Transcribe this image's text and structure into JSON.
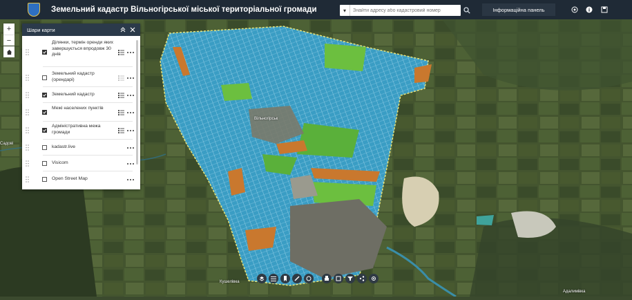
{
  "header": {
    "title": "Земельний кадастр Вільногірської міської територіальної громади",
    "search_placeholder": "Знайти адресу або кадастровий номер",
    "info_panel_label": "Інформаційна панель",
    "icons": [
      "search-icon",
      "map-icon",
      "info-icon",
      "save-icon"
    ]
  },
  "colors": {
    "header_bg": "#1f2a36",
    "parcel_blue": "#3a9dc4",
    "parcel_green": "#6cbf3f",
    "parcel_orange": "#c9782e",
    "boundary": "#e8e57a"
  },
  "map_controls": {
    "zoom_in": "+",
    "zoom_out": "−"
  },
  "layers_panel": {
    "title": "Шари карти",
    "layers": [
      {
        "name": "Ділянки, термін оренди яких завершується впродовж 30 днів",
        "checked": true,
        "legend": true
      },
      {
        "name": "Земельний кадастр (орендарі)",
        "checked": false,
        "legend": true
      },
      {
        "name": "Земельний кадастр",
        "checked": true,
        "legend": true
      },
      {
        "name": "Межі населених пунктів",
        "checked": true,
        "legend": true
      },
      {
        "name": "Адміністративна межа громади",
        "checked": true,
        "legend": true
      },
      {
        "name": "kadastr.live",
        "checked": false,
        "legend": false
      },
      {
        "name": "Visicom",
        "checked": false,
        "legend": false
      },
      {
        "name": "Open Street Map",
        "checked": false,
        "legend": false
      }
    ]
  },
  "toolbar": {
    "tools": [
      "layers-icon",
      "legend-icon",
      "bookmark-icon",
      "measure-icon",
      "draw-icon",
      "print-icon",
      "basemap-icon",
      "filter-icon",
      "share-icon",
      "locate-icon"
    ]
  },
  "map_labels": {
    "village_center": "Вільногірськ",
    "village_bottom": "Кушелівка",
    "west_edge": "Садові",
    "bottom_right": "Адалимівка"
  }
}
